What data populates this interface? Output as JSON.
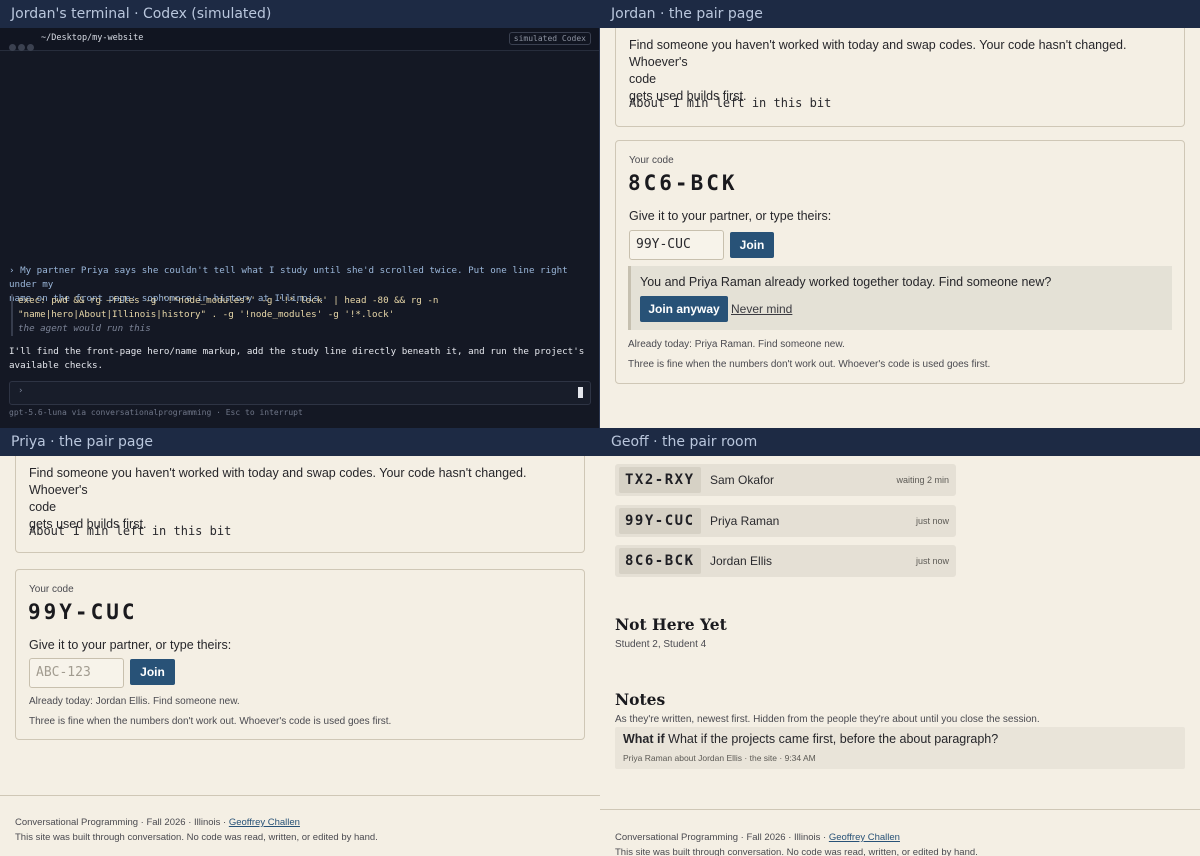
{
  "panes": {
    "terminal": {
      "title": "Jordan's terminal · Codex (simulated)",
      "path": "~/Desktop/my-website",
      "badge": "simulated Codex",
      "prompt_line1": "› My partner Priya says she couldn't tell what I study until she'd scrolled twice. Put one line right under my",
      "prompt_line2": "name on the front page: sophomore in history at Illinois.",
      "exec_line1": "exec: pwd && rg —files -g '!*node_modules*' -g '!*.lock' | head -80 && rg -n",
      "exec_line2": "\"name|hero|About|Illinois|history\" . -g '!node_modules' -g '!*.lock'",
      "exec_note": "the agent would run this",
      "reply_line1": "I'll find the front-page hero/name markup, add the study line directly beneath it, and run the project's",
      "reply_line2": "available checks.",
      "input_caret": "›",
      "status": "gpt-5.6-luna via conversationalprogramming  ·  Esc to interrupt"
    },
    "jordan": {
      "title": "Jordan · the pair page",
      "swap_line1": "Find someone you haven't worked with today and swap codes. Your code hasn't changed. Whoever's",
      "swap_line2": "code",
      "swap_line3": "gets used builds first.",
      "timer": "About 1 min left in this bit",
      "code_label": "Your code",
      "code": "8C6-BCK",
      "give_label": "Give it to your partner, or type theirs:",
      "input_value": "99Y-CUC",
      "join_label": "Join",
      "notice_text": "You and Priya Raman already worked together today. Find someone new?",
      "join_anyway_label": "Join anyway",
      "never_mind_label": "Never mind",
      "already": "Already today: Priya Raman. Find someone new.",
      "three_fine": "Three is fine when the numbers don't work out. Whoever's code is used goes first."
    },
    "priya": {
      "title": "Priya · the pair page",
      "swap_line1": "Find someone you haven't worked with today and swap codes. Your code hasn't changed. Whoever's",
      "swap_line2": "code",
      "swap_line3": "gets used builds first.",
      "timer": "About 1 min left in this bit",
      "code_label": "Your code",
      "code": "99Y-CUC",
      "give_label": "Give it to your partner, or type theirs:",
      "input_placeholder": "ABC-123",
      "join_label": "Join",
      "already": "Already today: Jordan Ellis. Find someone new.",
      "three_fine": "Three is fine when the numbers don't work out. Whoever's code is used goes first."
    },
    "geoff": {
      "title": "Geoff · the pair room",
      "room": [
        {
          "code": "TX2-RXY",
          "name": "Sam Okafor",
          "time": "waiting 2 min"
        },
        {
          "code": "99Y-CUC",
          "name": "Priya Raman",
          "time": "just now"
        },
        {
          "code": "8C6-BCK",
          "name": "Jordan Ellis",
          "time": "just now"
        }
      ],
      "not_here_heading": "Not Here Yet",
      "not_here_list": "Student 2, Student 4",
      "notes_heading": "Notes",
      "notes_sub": "As they're written, newest first. Hidden from the people they're about until you close the session.",
      "note_tag": "What if",
      "note_text": "What if the projects came first, before the about paragraph?",
      "note_meta": "Priya Raman about Jordan Ellis · the site · 9:34 AM"
    }
  },
  "footer": {
    "line1_prefix": "Conversational Programming  ·  Fall 2026  ·  Illinois  ·  ",
    "link": "Geoffrey Challen",
    "line2": "This site was built through conversation. No code was read, written, or edited by hand."
  },
  "colors": {
    "accent": "#285277",
    "titlebar": "#1d2a44",
    "terminal_bg": "#141824",
    "page_bg": "#f4efe4"
  }
}
